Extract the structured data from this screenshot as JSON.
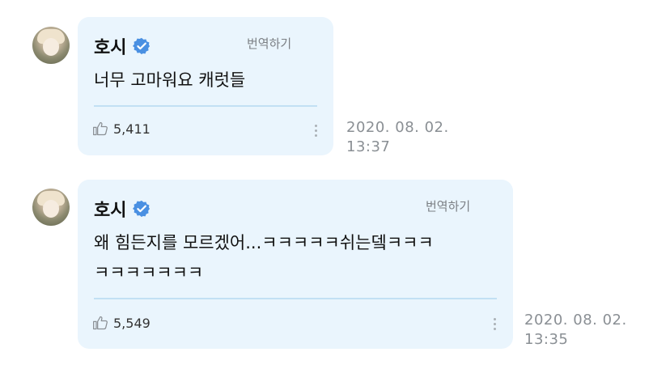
{
  "comments": [
    {
      "author": "호시",
      "translate_label": "번역하기",
      "text": "너무 고마워요 캐럿들",
      "likes": "5,411",
      "time_date": "2020. 08. 02.",
      "time_clock": "13:37"
    },
    {
      "author": "호시",
      "translate_label": "번역하기",
      "text_line1": "왜 힘든지를 모르겠어...ㅋㅋㅋㅋㅋ쉬는뎈ㅋㅋㅋ",
      "text_line2": "ㅋㅋㅋㅋㅋㅋㅋ",
      "likes": "5,549",
      "time_date": "2020. 08. 02.",
      "time_clock": "13:35"
    }
  ],
  "colors": {
    "bubble": "#eaf5fd",
    "verified": "#4a90e2",
    "divider": "#c2e0f4"
  },
  "icons": [
    "verified-badge-icon",
    "thumbs-up-icon",
    "more-options-icon"
  ]
}
